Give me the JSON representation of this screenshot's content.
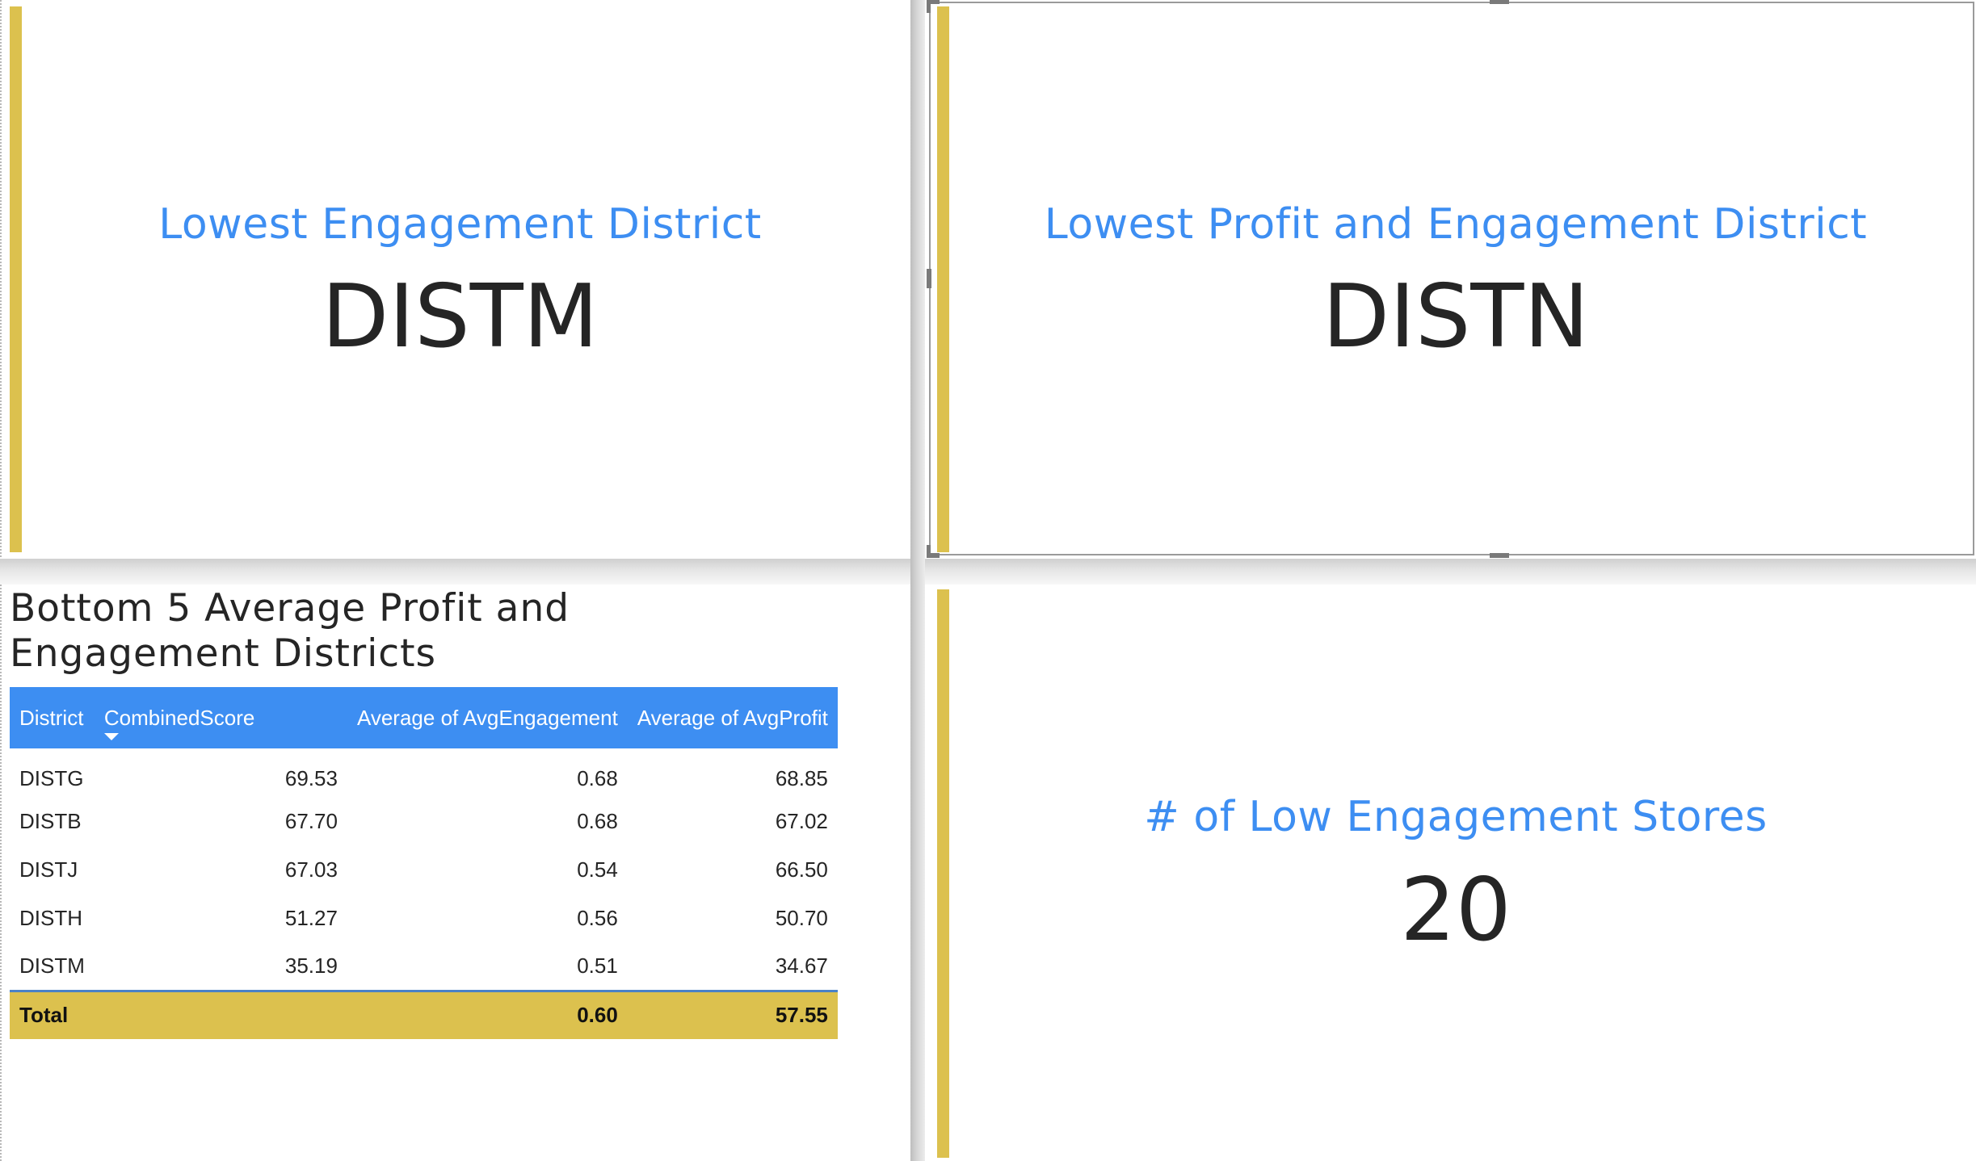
{
  "cards": {
    "lowest_engagement": {
      "title": "Lowest Engagement District",
      "value": "DISTM"
    },
    "lowest_profit_engagement": {
      "title": "Lowest Profit and Engagement District",
      "value": "DISTN"
    },
    "low_engagement_stores": {
      "title": "# of Low Engagement Stores",
      "value": "20"
    }
  },
  "table": {
    "title": "Bottom 5 Average Profit and Engagement Districts",
    "columns": [
      "District",
      "CombinedScore",
      "Average of AvgEngagement",
      "Average of AvgProfit"
    ],
    "sorted_column": "CombinedScore",
    "rows": [
      [
        "DISTG",
        "69.53",
        "0.68",
        "68.85"
      ],
      [
        "DISTB",
        "67.70",
        "0.68",
        "67.02"
      ],
      [
        "DISTJ",
        "67.03",
        "0.54",
        "66.50"
      ],
      [
        "DISTH",
        "51.27",
        "0.56",
        "50.70"
      ],
      [
        "DISTM",
        "35.19",
        "0.51",
        "34.67"
      ]
    ],
    "total": [
      "Total",
      "",
      "0.60",
      "57.55"
    ]
  },
  "colors": {
    "accent": "#dcc14e",
    "title_blue": "#3d8ef2",
    "header_blue": "#3d8ef2",
    "value_text": "#252525"
  }
}
